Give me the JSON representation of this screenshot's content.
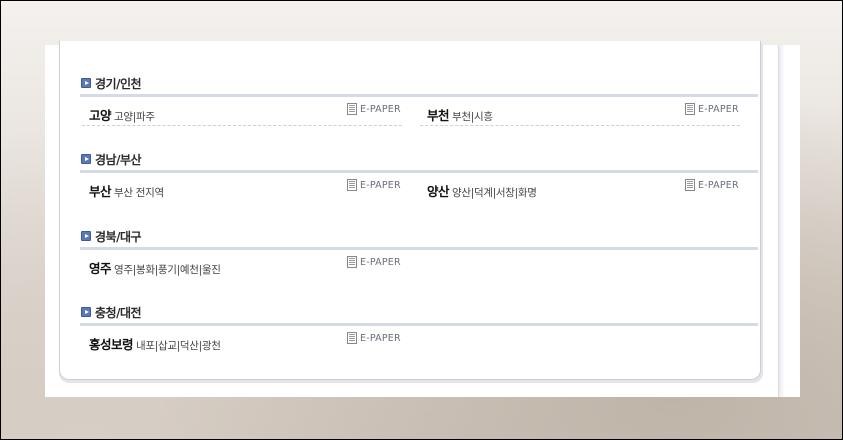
{
  "sections": [
    {
      "title": "경기/인천",
      "entries": [
        {
          "name": "고양",
          "areas": "고양|파주",
          "epaper": "E-PAPER"
        },
        {
          "name": "부천",
          "areas": "부천|시흥",
          "epaper": "E-PAPER"
        }
      ]
    },
    {
      "title": "경남/부산",
      "entries": [
        {
          "name": "부산",
          "areas": "부산 전지역",
          "epaper": "E-PAPER"
        },
        {
          "name": "양산",
          "areas": "양산|덕계|서창|화명",
          "epaper": "E-PAPER"
        }
      ]
    },
    {
      "title": "경북/대구",
      "entries": [
        {
          "name": "영주",
          "areas": "영주|봉화|풍기|예천|울진",
          "epaper": "E-PAPER"
        }
      ]
    },
    {
      "title": "충청/대전",
      "entries": [
        {
          "name": "홍성보령",
          "areas": "내포|삽교|덕산|광천",
          "epaper": "E-PAPER"
        }
      ]
    }
  ],
  "icons": {
    "section": "play-arrow-icon",
    "epaper": "document-icon"
  },
  "colors": {
    "section_icon": "#5b79b8",
    "divider": "#d5dbe6"
  }
}
